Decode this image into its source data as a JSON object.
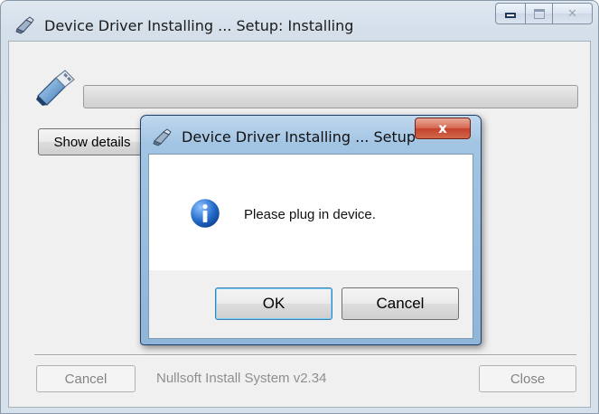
{
  "main_window": {
    "title": "Device Driver Installing ... Setup: Installing",
    "icons": {
      "title": "installer-icon",
      "content": "usb-drive-icon"
    },
    "caption_buttons": {
      "minimize": "minimize-icon",
      "maximize": "maximize-icon",
      "close": "close-icon"
    },
    "progress_value": 0,
    "show_details_label": "Show details",
    "branding": "Nullsoft Install System v2.34",
    "cancel_label": "Cancel",
    "close_label": "Close"
  },
  "dialog": {
    "title": "Device Driver Installing ... Setup",
    "close_glyph": "x",
    "message": "Please plug in device.",
    "icon": "info-icon",
    "ok_label": "OK",
    "cancel_label": "Cancel"
  },
  "colors": {
    "title_bar": "#d4dfea",
    "dialog_title_bar": "#a3c5e4",
    "close_button": "#c4412b",
    "info_icon": "#1f66c6"
  }
}
